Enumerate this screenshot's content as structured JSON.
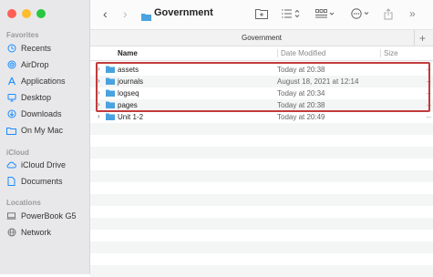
{
  "window": {
    "title": "Government",
    "path_label": "Government"
  },
  "sidebar": {
    "sections": [
      {
        "title": "Favorites",
        "items": [
          {
            "label": "Recents",
            "icon": "clock-icon"
          },
          {
            "label": "AirDrop",
            "icon": "airdrop-icon"
          },
          {
            "label": "Applications",
            "icon": "applications-icon"
          },
          {
            "label": "Desktop",
            "icon": "desktop-icon"
          },
          {
            "label": "Downloads",
            "icon": "downloads-icon"
          },
          {
            "label": "On My Mac",
            "icon": "folder-icon"
          }
        ]
      },
      {
        "title": "iCloud",
        "items": [
          {
            "label": "iCloud Drive",
            "icon": "cloud-icon"
          },
          {
            "label": "Documents",
            "icon": "document-icon"
          }
        ]
      },
      {
        "title": "Locations",
        "items": [
          {
            "label": "PowerBook G5",
            "icon": "laptop-icon"
          },
          {
            "label": "Network",
            "icon": "globe-icon"
          }
        ]
      }
    ]
  },
  "columns": {
    "name": "Name",
    "date": "Date Modified",
    "size": "Size"
  },
  "files": [
    {
      "name": "assets",
      "date": "Today at 20:38",
      "size": "--"
    },
    {
      "name": "journals",
      "date": "August 18, 2021 at 12:14",
      "size": "--"
    },
    {
      "name": "logseq",
      "date": "Today at 20:34",
      "size": "--"
    },
    {
      "name": "pages",
      "date": "Today at 20:38",
      "size": "--"
    },
    {
      "name": "Unit 1-2",
      "date": "Today at 20:49",
      "size": "--"
    }
  ],
  "colors": {
    "accent": "#1a8cff",
    "folder": "#4aa3df",
    "highlight": "#c23b3b"
  }
}
